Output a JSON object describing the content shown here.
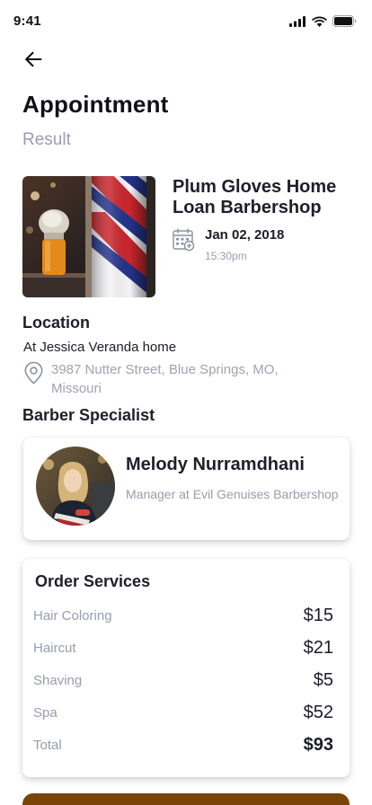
{
  "status_bar": {
    "time": "9:41"
  },
  "header": {
    "title": "Appointment",
    "subtitle": "Result"
  },
  "appointment": {
    "shop_name": "Plum Gloves Home Loan Barbershop",
    "date": "Jan 02, 2018",
    "time": "15:30pm"
  },
  "location": {
    "heading": "Location",
    "place": "At Jessica Veranda home",
    "address": "3987  Nutter Street, Blue Springs, MO, Missouri"
  },
  "barber": {
    "heading": "Barber Specialist",
    "name": "Melody Nurramdhani",
    "role": "Manager at Evil Genuises Barbershop"
  },
  "order": {
    "title": "Order Services",
    "items": [
      {
        "label": "Hair Coloring",
        "price": "$15"
      },
      {
        "label": "Haircut",
        "price": "$21"
      },
      {
        "label": "Shaving",
        "price": "$5"
      },
      {
        "label": "Spa",
        "price": "$52"
      },
      {
        "label": "Total",
        "price": "$93"
      }
    ]
  },
  "colors": {
    "accent": "#7a4408",
    "muted_text": "#9a9cb0",
    "primary_text": "#1c1c28"
  },
  "icons": [
    "back-arrow-icon",
    "calendar-icon",
    "location-pin-icon",
    "signal-icon",
    "wifi-icon",
    "battery-icon"
  ]
}
